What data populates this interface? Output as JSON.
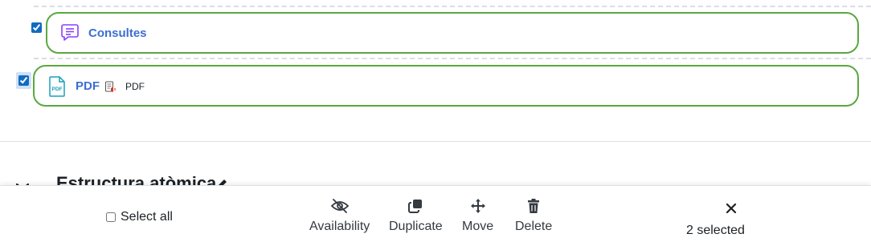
{
  "activities": [
    {
      "name": "Consultes",
      "icon": "chat-bubble-icon",
      "checked": true,
      "accent": "#8a3ffc"
    },
    {
      "name": "PDF",
      "icon": "pdf-file-icon",
      "checked": true,
      "extra": "PDF",
      "accent": "#1a9fbf"
    }
  ],
  "section": {
    "title": "Estructura atòmica"
  },
  "bulk_edit": {
    "select_all_label": "Select all",
    "actions": [
      {
        "label": "Availability",
        "icon": "eye-slash-icon"
      },
      {
        "label": "Duplicate",
        "icon": "copy-icon"
      },
      {
        "label": "Move",
        "icon": "move-arrows-icon"
      },
      {
        "label": "Delete",
        "icon": "trash-icon"
      }
    ],
    "selected_text": "2 selected"
  },
  "colors": {
    "border_green": "#59a83f",
    "link_blue": "#3b6fd1",
    "checkbox_blue": "#0f6cbf"
  }
}
